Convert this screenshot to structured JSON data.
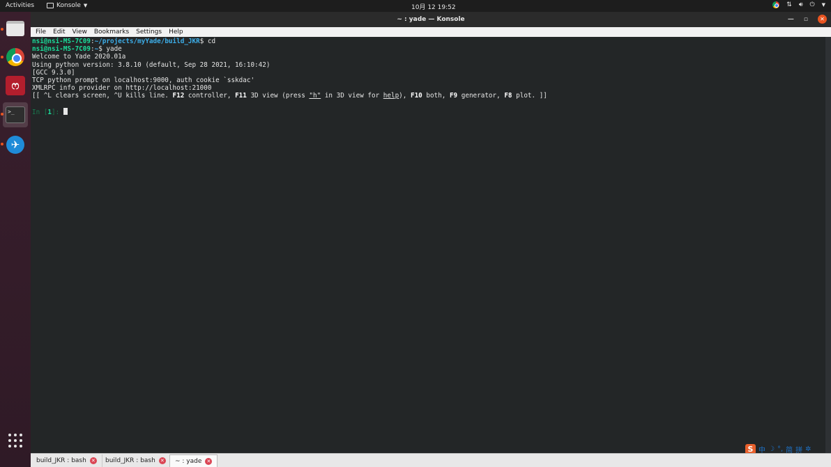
{
  "topbar": {
    "activities": "Activities",
    "app_name": "Konsole",
    "clock": "10月 12  19:52",
    "tray_icons": [
      "chrome-icon",
      "network-icon",
      "volume-icon",
      "power-icon"
    ]
  },
  "dock": {
    "items": [
      {
        "name": "files",
        "icon": "files-icon",
        "running": true
      },
      {
        "name": "chrome",
        "icon": "chrome-icon",
        "running": true
      },
      {
        "name": "mendeley",
        "icon": "mendeley-icon",
        "running": false
      },
      {
        "name": "terminal",
        "icon": "terminal-icon",
        "running": true,
        "active": true
      },
      {
        "name": "kite",
        "icon": "kite-icon",
        "running": true
      }
    ]
  },
  "window": {
    "title": "~ : yade — Konsole",
    "menu": [
      "File",
      "Edit",
      "View",
      "Bookmarks",
      "Settings",
      "Help"
    ]
  },
  "terminal": {
    "line1": {
      "user": "nsi@nsi-MS-7C09",
      "sep": ":",
      "path": "~/projects/myYade/build_JKR",
      "cmd": "$ cd"
    },
    "line2": {
      "user": "nsi@nsi-MS-7C09",
      "sep": ":",
      "path": "~",
      "cmd": "$ yade"
    },
    "welcome": "Welcome to Yade 2020.01a",
    "python": "Using python version: 3.8.10 (default, Sep 28 2021, 16:10:42)",
    "gcc": "[GCC 9.3.0]",
    "tcp": "TCP python prompt on localhost:9000, auth cookie `sskdac'",
    "xmlrpc": "XMLRPC info provider on http://localhost:21000",
    "help": {
      "p1": "[[ ^L clears screen, ^U kills line. ",
      "f12": "F12",
      "p2": " controller, ",
      "f11": "F11",
      "p3": " 3D view (press ",
      "h": "\"h\"",
      "p4": " in 3D view for ",
      "helpword": "help",
      "p5": "), ",
      "f10": "F10",
      "p6": " both, ",
      "f9": "F9",
      "p7": " generator, ",
      "f8": "F8",
      "p8": " plot. ]]"
    },
    "prompt": {
      "in": "In [",
      "num": "1",
      "close": "]: "
    }
  },
  "tabs": [
    {
      "label": "build_JKR : bash",
      "active": false
    },
    {
      "label": "build_JKR : bash",
      "active": false
    },
    {
      "label": "~ : yade",
      "active": true
    }
  ],
  "ime": {
    "logo": "S",
    "lang": "中",
    "punct": "°,",
    "chars": "简",
    "pinyin": "拼"
  }
}
